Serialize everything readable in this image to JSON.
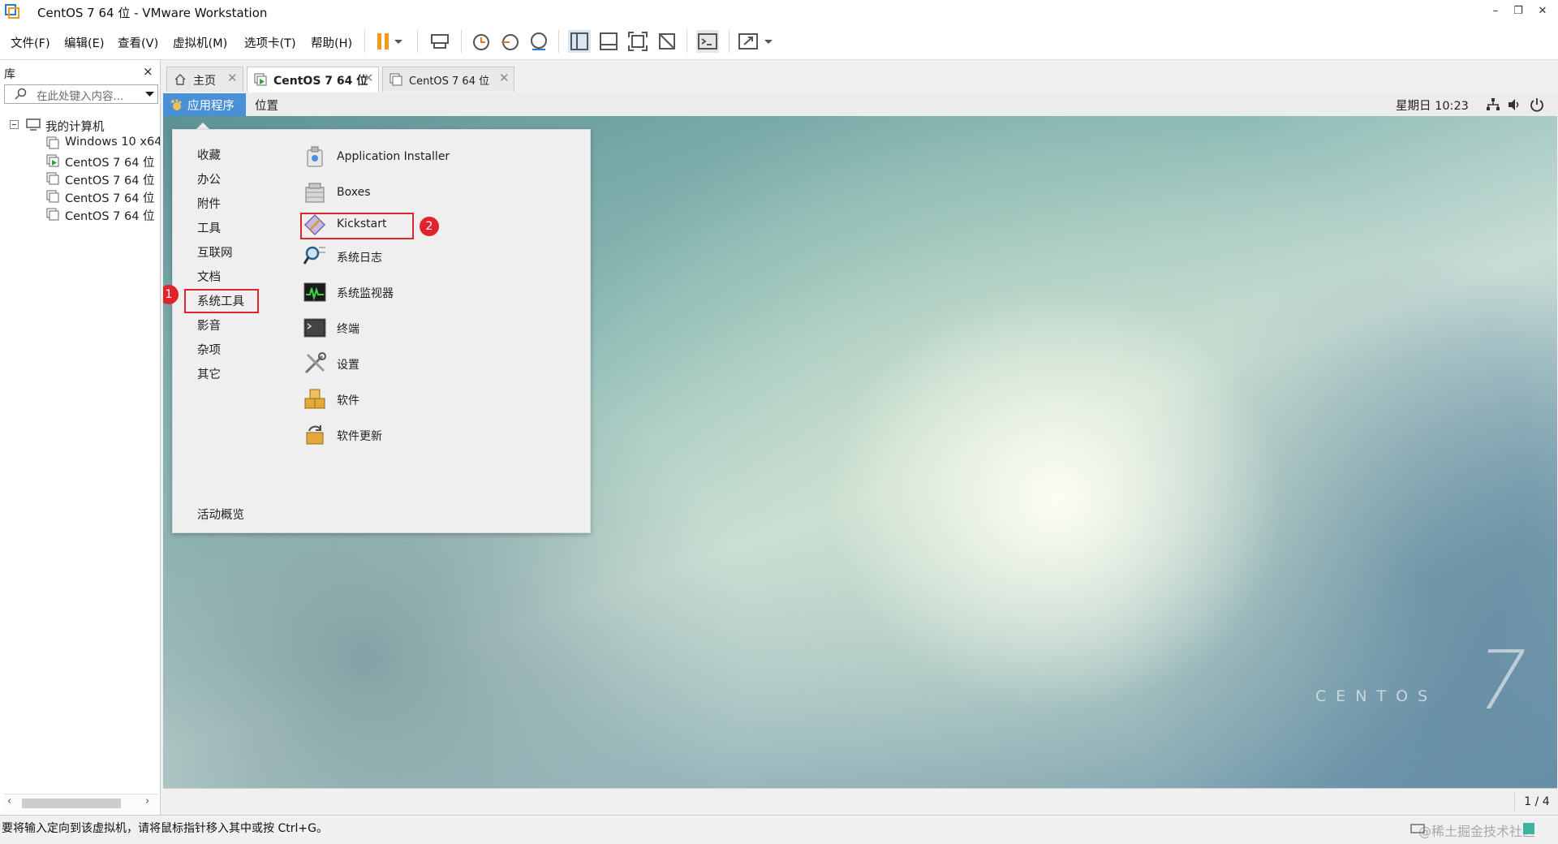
{
  "window": {
    "title": "CentOS 7 64 位 - VMware Workstation",
    "controls": {
      "minimize": "–",
      "restore": "❐",
      "close": "✕"
    }
  },
  "menubar": {
    "items": [
      "文件(F)",
      "编辑(E)",
      "查看(V)",
      "虚拟机(M)",
      "选项卡(T)",
      "帮助(H)"
    ]
  },
  "toolbar": {
    "icons": [
      "pause-icon",
      "dropdown-arrow-icon",
      "send-keys-icon",
      "snapshot-icon",
      "revert-snapshot-icon",
      "snapshot-manager-icon",
      "library-view-icon",
      "thumbnail-bar-icon",
      "fullscreen-icon",
      "unity-icon",
      "console-icon",
      "stretch-icon",
      "dropdown-arrow-icon"
    ]
  },
  "library": {
    "title": "库",
    "close": "×",
    "search_placeholder": "在此处键入内容...",
    "tree": {
      "root": "我的计算机",
      "items": [
        "Windows 10 x64",
        "CentOS 7 64 位",
        "CentOS 7 64 位",
        "CentOS 7 64 位",
        "CentOS 7 64 位"
      ]
    }
  },
  "tabs": [
    {
      "label": "主页",
      "active": false
    },
    {
      "label": "CentOS 7 64 位",
      "active": true
    },
    {
      "label": "CentOS 7 64 位",
      "active": false
    }
  ],
  "tab_close": "✕",
  "guest": {
    "topbar": {
      "applications": "应用程序",
      "places": "位置",
      "clock": "星期日 10:23"
    },
    "menu": {
      "categories": [
        "收藏",
        "办公",
        "附件",
        "工具",
        "互联网",
        "文档",
        "系统工具",
        "影音",
        "杂项",
        "其它"
      ],
      "selected_category": "系统工具",
      "apps": [
        "Application Installer",
        "Boxes",
        "Kickstart",
        "系统日志",
        "系统监视器",
        "终端",
        "设置",
        "软件",
        "软件更新"
      ],
      "highlighted_app": "Kickstart",
      "activities": "活动概览"
    },
    "badges": [
      "1",
      "2"
    ],
    "wallpaper": {
      "number": "7",
      "word": "CENTOS"
    }
  },
  "vm_bottom": {
    "page_indicator": "1 / 4"
  },
  "statusbar": {
    "text": "要将输入定向到该虚拟机，请将鼠标指针移入其中或按 Ctrl+G。",
    "watermark": "@稀土掘金技术社区"
  },
  "colors": {
    "accent": "#4a90d9",
    "highlight": "#e0242c"
  }
}
